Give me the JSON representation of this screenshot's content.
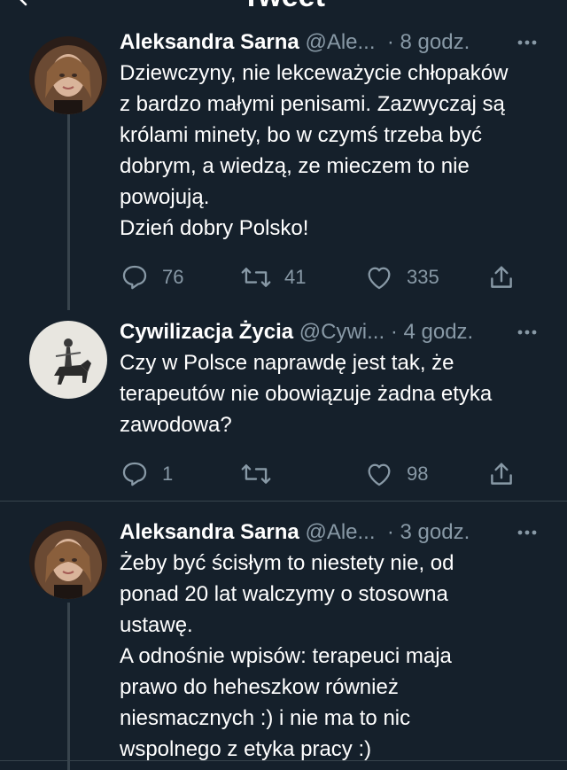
{
  "header": {
    "title": "Tweet"
  },
  "tweets": [
    {
      "name": "Aleksandra Sarna",
      "handle": "@Ale...",
      "time": "8 godz.",
      "text": "Dziewczyny, nie lekceważycie chłopaków\nz bardzo małymi penisami. Zazwyczaj są\nkrólami minety, bo w czymś trzeba być\ndobrym, a wiedzą, ze mieczem to nie\npowojują.\nDzień dobry Polsko!",
      "replies": "76",
      "retweets": "41",
      "likes": "335"
    },
    {
      "name": "Cywilizacja Życia",
      "handle": "@Cywi...",
      "time": "4 godz.",
      "text": "Czy w Polsce naprawdę jest tak, że\nterapeutów nie obowiązuje żadna etyka\nzawodowa?",
      "replies": "1",
      "retweets": "",
      "likes": "98"
    },
    {
      "name": "Aleksandra Sarna",
      "handle": "@Ale...",
      "time": "3 godz.",
      "text": "Żeby być ścisłym to niestety nie, od\nponad 20 lat walczymy o stosowna\nustawę.\nA odnośnie wpisów: terapeuci maja\nprawo do heheszkow również\nniesmacznych :) i nie ma to nic\nwspolnego z etyka pracy :)"
    }
  ],
  "icons": {
    "back": "back-arrow-icon",
    "more": "more-icon",
    "reply": "reply-icon",
    "retweet": "retweet-icon",
    "like": "like-icon",
    "share": "share-icon"
  },
  "colors": {
    "background": "#15202b",
    "secondary_text": "#8899a6",
    "divider": "#38444d"
  }
}
